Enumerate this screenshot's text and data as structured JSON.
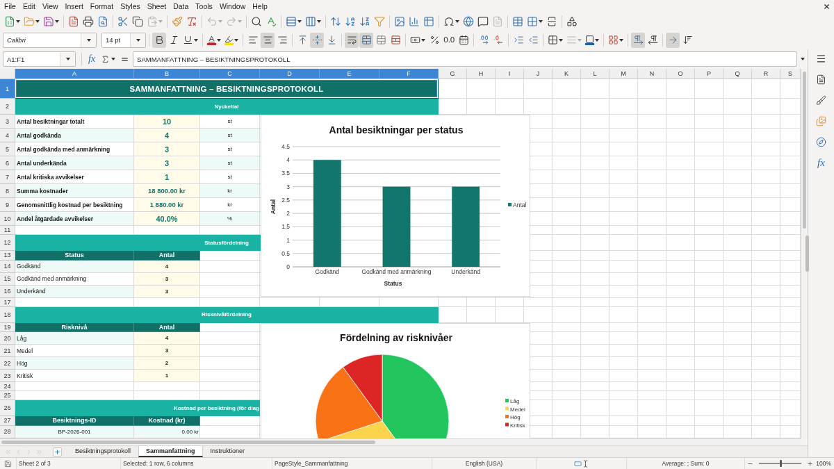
{
  "menu_bar": [
    "File",
    "Edit",
    "View",
    "Insert",
    "Format",
    "Styles",
    "Sheet",
    "Data",
    "Tools",
    "Window",
    "Help"
  ],
  "standard_toolbar": [
    {
      "disabled": false
    },
    {
      "disabled": false
    },
    {
      "disabled": false
    },
    {
      "disabled": false
    },
    {
      "disabled": false
    },
    {
      "disabled": false
    },
    {
      "disabled": false
    },
    {
      "disabled": false
    },
    {
      "disabled": true
    },
    {
      "disabled": false
    },
    {
      "disabled": false
    },
    {
      "disabled": true
    },
    {
      "disabled": true
    },
    {
      "disabled": false
    },
    {
      "disabled": false
    },
    {
      "disabled": false
    },
    {
      "disabled": false
    },
    {
      "disabled": false
    },
    {
      "disabled": false
    },
    {
      "disabled": false
    },
    {
      "disabled": false
    },
    {
      "disabled": false
    },
    {
      "disabled": false
    },
    {
      "disabled": false
    },
    {
      "disabled": false
    },
    {
      "disabled": false
    },
    {
      "disabled": false
    },
    {
      "disabled": true
    },
    {
      "disabled": false
    },
    {
      "disabled": false
    },
    {
      "disabled": false
    },
    {
      "disabled": false
    }
  ],
  "formatting_toolbar": {
    "font_name": "Calibri",
    "font_size": "14 pt",
    "buttons": [
      {
        "active": true,
        "disabled": false
      },
      {
        "active": false,
        "disabled": false
      },
      {
        "active": false,
        "disabled": false
      },
      {
        "active": false,
        "disabled": false
      },
      {
        "active": false,
        "disabled": false
      },
      {
        "active": false,
        "disabled": false
      },
      {
        "active": true,
        "disabled": false
      },
      {
        "active": false,
        "disabled": false
      },
      {
        "active": false,
        "disabled": false
      },
      {
        "active": true,
        "disabled": false
      },
      {
        "active": false,
        "disabled": false
      },
      {
        "active": true,
        "disabled": false
      },
      {
        "active": true,
        "disabled": false
      },
      {
        "active": false,
        "disabled": false
      },
      {
        "active": false,
        "disabled": false
      },
      {
        "active": false,
        "disabled": false
      },
      {
        "active": false,
        "disabled": false
      },
      {
        "active": false,
        "disabled": false,
        "label": "0.0"
      },
      {
        "active": false,
        "disabled": false
      },
      {
        "active": false,
        "disabled": false
      },
      {
        "active": false,
        "disabled": false
      },
      {
        "active": false,
        "disabled": false
      },
      {
        "active": false,
        "disabled": false
      },
      {
        "active": false,
        "disabled": false
      },
      {
        "active": false,
        "disabled": true
      },
      {
        "active": false,
        "disabled": false
      },
      {
        "active": false,
        "disabled": false
      },
      {
        "active": true,
        "disabled": false
      },
      {
        "active": false,
        "disabled": false
      },
      {
        "active": true,
        "disabled": false
      },
      {
        "active": false,
        "disabled": false
      }
    ]
  },
  "formula_bar": {
    "name_box": "A1:F1",
    "function_label": "fx",
    "content": "SAMMANFATTNING – BESIKTNINGSPROTOKOLL"
  },
  "sheet": {
    "columns": [
      {
        "label": "A",
        "selected": true
      },
      {
        "label": "B",
        "selected": true
      },
      {
        "label": "C",
        "selected": true
      },
      {
        "label": "D",
        "selected": true
      },
      {
        "label": "E",
        "selected": true
      },
      {
        "label": "F",
        "selected": true
      },
      {
        "label": "G",
        "selected": false
      },
      {
        "label": "H",
        "selected": false
      },
      {
        "label": "I",
        "selected": false
      },
      {
        "label": "J",
        "selected": false
      },
      {
        "label": "K",
        "selected": false
      },
      {
        "label": "L",
        "selected": false
      },
      {
        "label": "M",
        "selected": false
      },
      {
        "label": "N",
        "selected": false
      },
      {
        "label": "O",
        "selected": false
      },
      {
        "label": "P",
        "selected": false
      },
      {
        "label": "Q",
        "selected": false
      },
      {
        "label": "R",
        "selected": false
      },
      {
        "label": "S",
        "selected": false
      }
    ],
    "rows": [
      {
        "number": "1",
        "selected": true,
        "kind": "title",
        "text": "SAMMANFATTNING – BESIKTNINGSPROTOKOLL"
      },
      {
        "number": "2",
        "selected": false,
        "kind": "band",
        "text": "Nyckeltal"
      },
      {
        "number": "3",
        "selected": false,
        "kind": "metric",
        "cells": [
          "Antal besiktningar totalt",
          "10",
          "st"
        ]
      },
      {
        "number": "4",
        "selected": false,
        "kind": "metric",
        "cells": [
          "Antal godkända",
          "4",
          "st"
        ]
      },
      {
        "number": "5",
        "selected": false,
        "kind": "metric",
        "cells": [
          "Antal godkända med anmärkning",
          "3",
          "st"
        ]
      },
      {
        "number": "6",
        "selected": false,
        "kind": "metric",
        "cells": [
          "Antal underkända",
          "3",
          "st"
        ]
      },
      {
        "number": "7",
        "selected": false,
        "kind": "metric",
        "cells": [
          "Antal kritiska avvikelser",
          "1",
          "st"
        ]
      },
      {
        "number": "8",
        "selected": false,
        "kind": "metric",
        "cells": [
          "Summa kostnader",
          "18 800.00 kr",
          "kr"
        ]
      },
      {
        "number": "9",
        "selected": false,
        "kind": "metric",
        "cells": [
          "Genomsnittlig kostnad per besiktning",
          "1 880.00 kr",
          "kr"
        ]
      },
      {
        "number": "10",
        "selected": false,
        "kind": "metric",
        "cells": [
          "Andel åtgärdade avvikelser",
          "40.0%",
          "%"
        ]
      },
      {
        "number": "11",
        "selected": false,
        "kind": "empty"
      },
      {
        "number": "12",
        "selected": false,
        "kind": "band",
        "text": "Statusfördelning"
      },
      {
        "number": "13",
        "selected": false,
        "kind": "header",
        "cells": [
          "Status",
          "Antal"
        ]
      },
      {
        "number": "14",
        "selected": false,
        "kind": "count",
        "cells": [
          "Godkänd",
          "4"
        ]
      },
      {
        "number": "15",
        "selected": false,
        "kind": "count",
        "cells": [
          "Godkänd med anmärkning",
          "3"
        ]
      },
      {
        "number": "16",
        "selected": false,
        "kind": "count",
        "cells": [
          "Underkänd",
          "3"
        ]
      },
      {
        "number": "17",
        "selected": false,
        "kind": "empty"
      },
      {
        "number": "18",
        "selected": false,
        "kind": "band",
        "text": "Risknivåfördelning"
      },
      {
        "number": "19",
        "selected": false,
        "kind": "header",
        "cells": [
          "Risknivå",
          "Antal"
        ]
      },
      {
        "number": "20",
        "selected": false,
        "kind": "count",
        "cells": [
          "Låg",
          "4"
        ]
      },
      {
        "number": "21",
        "selected": false,
        "kind": "count",
        "cells": [
          "Medel",
          "3"
        ]
      },
      {
        "number": "22",
        "selected": false,
        "kind": "count",
        "cells": [
          "Hög",
          "2"
        ]
      },
      {
        "number": "23",
        "selected": false,
        "kind": "count",
        "cells": [
          "Kritisk",
          "1"
        ]
      },
      {
        "number": "24",
        "selected": false,
        "kind": "empty"
      },
      {
        "number": "25",
        "selected": false,
        "kind": "empty"
      },
      {
        "number": "26",
        "selected": false,
        "kind": "band_cut",
        "text": "Kostnad per besiktning (för diag"
      },
      {
        "number": "27",
        "selected": false,
        "kind": "header",
        "cells": [
          "Besiktnings-ID",
          "Kostnad (kr)"
        ]
      },
      {
        "number": "28",
        "selected": false,
        "kind": "cost",
        "cells": [
          "BP-2026-001",
          "0.00 kr"
        ]
      }
    ]
  },
  "charts": [
    {
      "chart_data": {
        "type": "bar",
        "title": "Antal besiktningar per status",
        "xlabel": "Status",
        "ylabel": "Antal",
        "categories": [
          "Godkänd",
          "Godkänd med anmärkning",
          "Underkänd"
        ],
        "series": [
          {
            "name": "Antal",
            "color": "#12766d",
            "values": [
              4,
              3,
              3
            ]
          }
        ],
        "ylim": [
          0,
          4.5
        ],
        "yticks": [
          0,
          0.5,
          1,
          1.5,
          2,
          2.5,
          3,
          3.5,
          4,
          4.5
        ],
        "grid": true,
        "legend": "right"
      }
    },
    {
      "chart_data": {
        "type": "pie",
        "title": "Fördelning av risknivåer",
        "categories": [
          "Låg",
          "Medel",
          "Hög",
          "Kritisk"
        ],
        "values": [
          40,
          30,
          20,
          10
        ],
        "legend": "right"
      },
      "slices": [
        {
          "color": "#22c55e"
        },
        {
          "color": "#fcd34d"
        },
        {
          "color": "#f97316"
        },
        {
          "color": "#dc2626"
        }
      ]
    }
  ],
  "sheet_tabs": {
    "nav_buttons": [
      {
        "disabled": true
      },
      {
        "disabled": true
      },
      {
        "disabled": true
      },
      {
        "disabled": true
      }
    ],
    "tabs": [
      {
        "label": "Besiktningsprotokoll",
        "selected": false
      },
      {
        "label": "Sammanfattning",
        "selected": true
      },
      {
        "label": "Instruktioner",
        "selected": false
      }
    ]
  },
  "status_bar": {
    "sheet": "Sheet 2 of 3",
    "selection": "Selected: 1 row, 6 columns",
    "page_style": "PageStyle_Sammanfattning",
    "language": "English (USA)",
    "statistics": "Average: ; Sum: 0",
    "zoom": {
      "level": 0.5,
      "reading": "100%"
    }
  },
  "sidebar": {
    "functions_label": "fx"
  }
}
